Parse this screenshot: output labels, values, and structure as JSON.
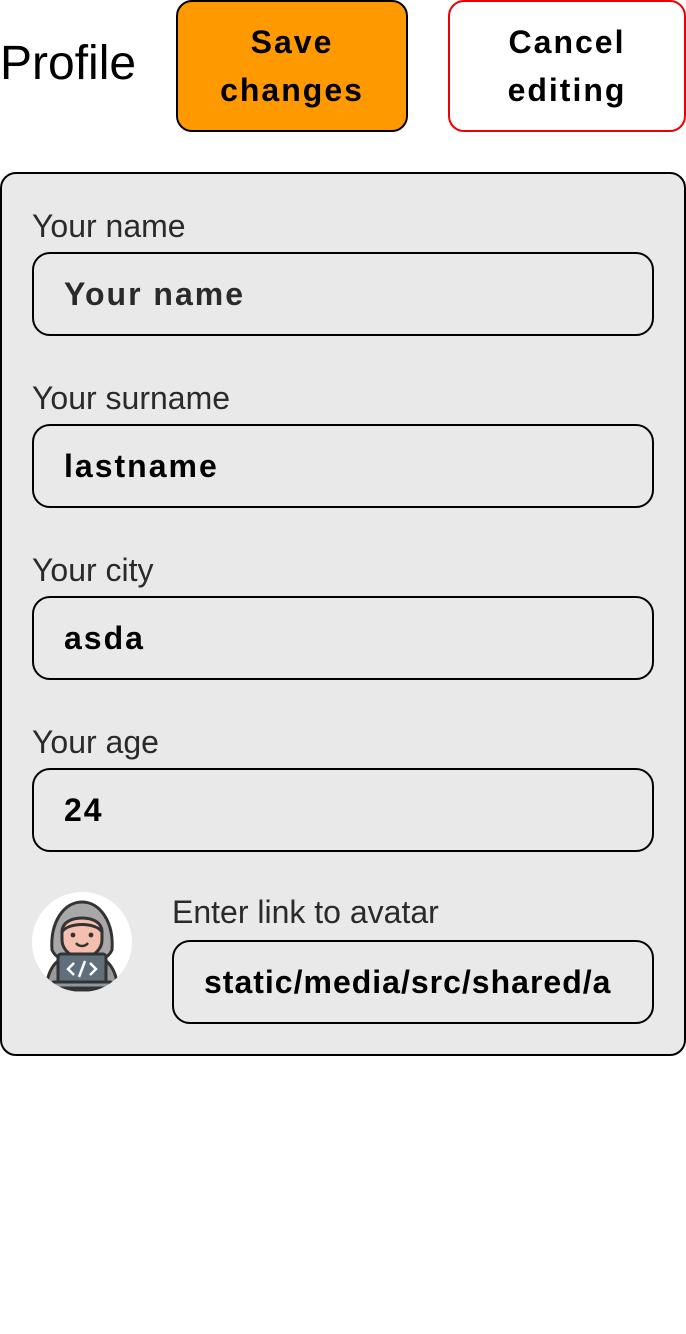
{
  "header": {
    "title": "Profile",
    "save_label": "Save changes",
    "cancel_label": "Cancel editing"
  },
  "form": {
    "name": {
      "label": "Your name",
      "value": "",
      "placeholder": "Your name"
    },
    "surname": {
      "label": "Your surname",
      "value": "lastname"
    },
    "city": {
      "label": "Your city",
      "value": "asda"
    },
    "age": {
      "label": "Your age",
      "value": "24"
    },
    "avatar": {
      "label": "Enter link to avatar",
      "value": "static/media/src/shared/a",
      "icon": "hacker-avatar-icon"
    }
  },
  "colors": {
    "save_bg": "#fe9900",
    "cancel_border": "#ee0000",
    "card_bg": "#e9e9e9"
  }
}
